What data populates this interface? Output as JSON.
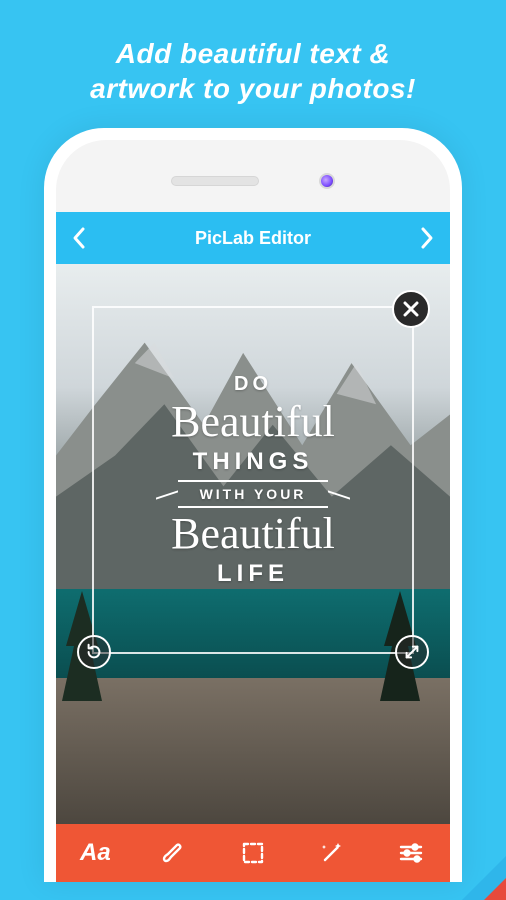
{
  "marketing": {
    "headline_l1": "Add beautiful text &",
    "headline_l2": "artwork to your photos!"
  },
  "app": {
    "header": {
      "title": "PicLab Editor"
    },
    "artwork": {
      "line_do": "DO",
      "line_beautiful1": "Beautiful",
      "line_things": "THINGS",
      "line_banner": "WITH  YOUR",
      "line_beautiful2": "Beautiful",
      "line_life": "LIFE"
    },
    "toolbar": {
      "text_label": "Aa"
    }
  }
}
